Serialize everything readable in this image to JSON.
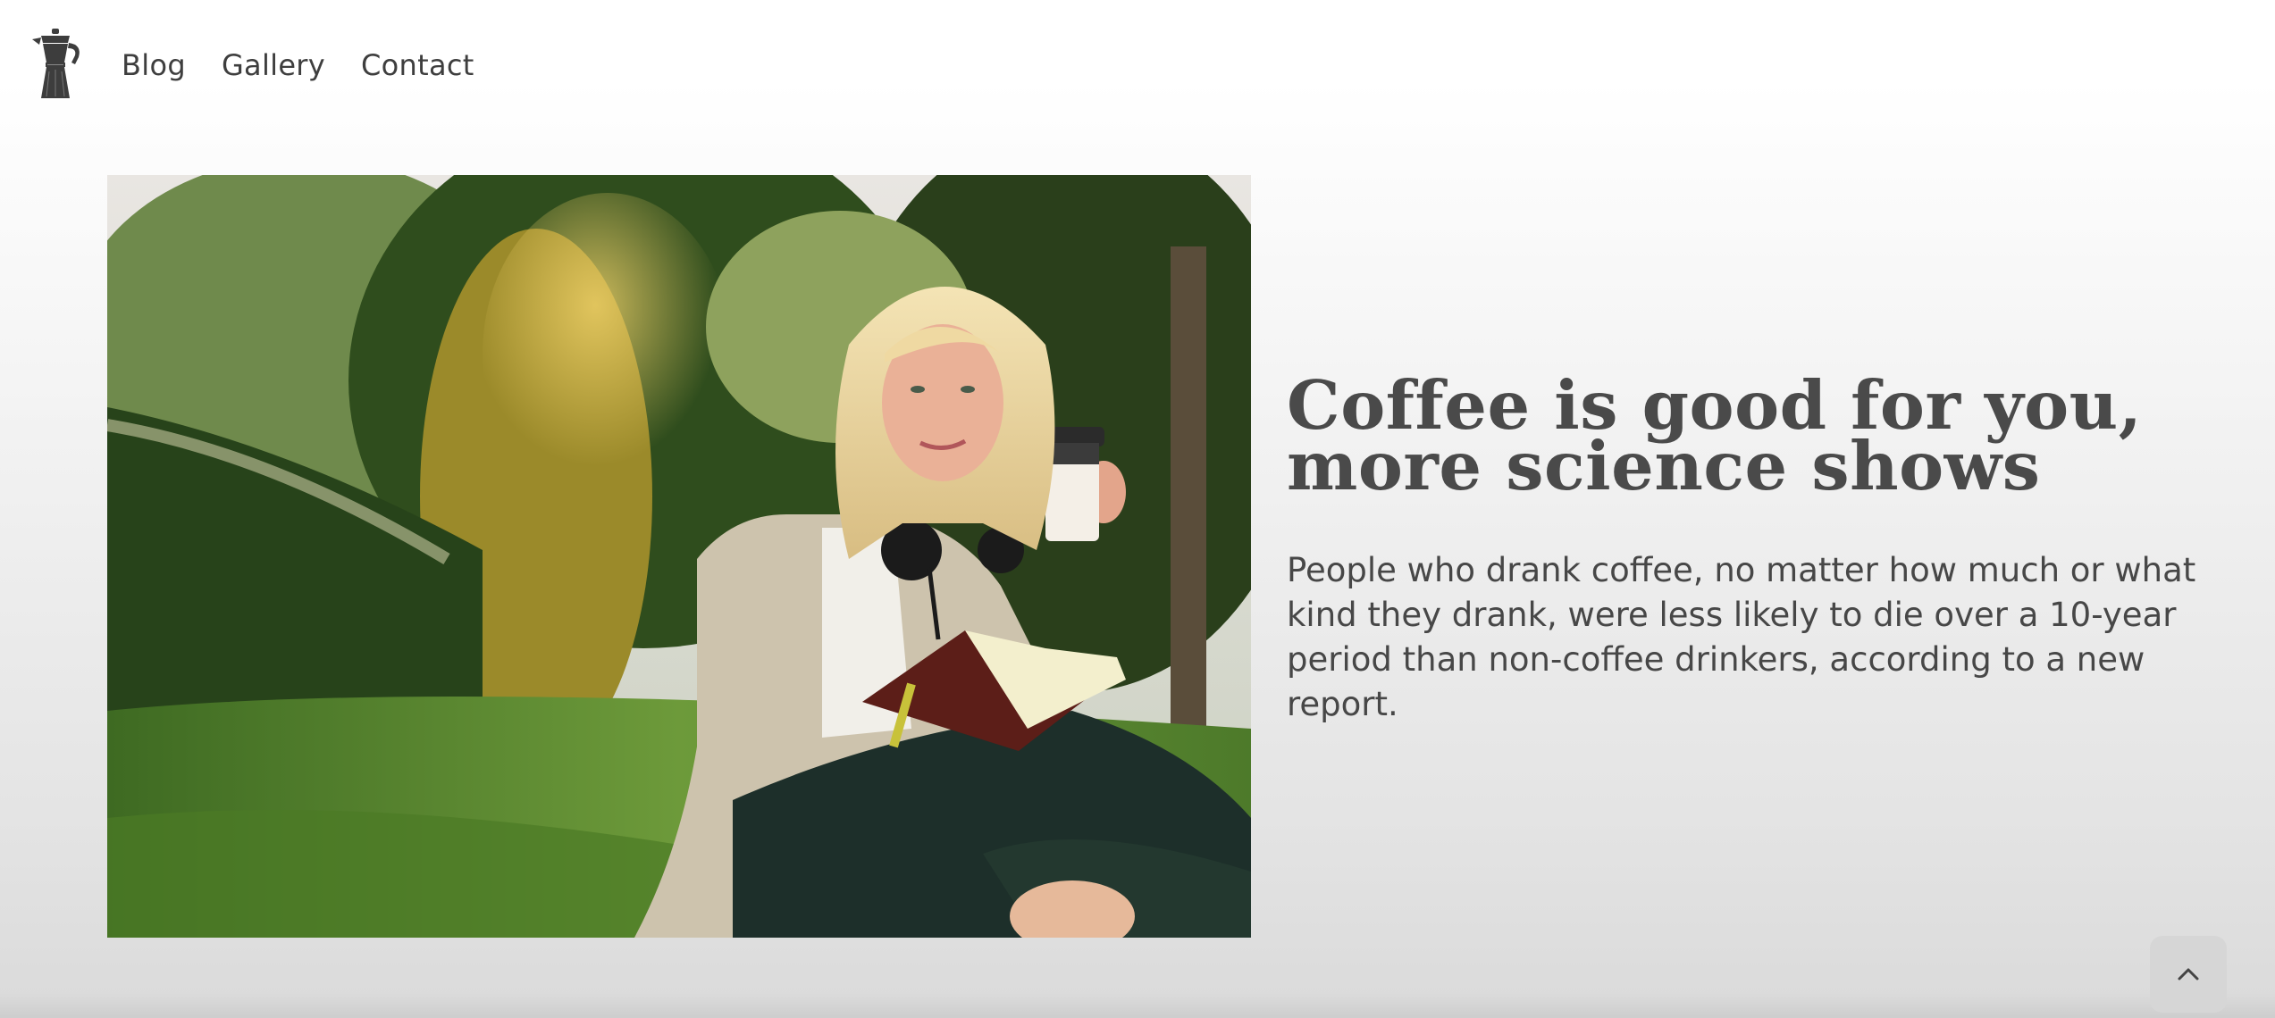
{
  "header": {
    "logo_icon": "moka-pot-icon",
    "nav": [
      {
        "label": "Blog"
      },
      {
        "label": "Gallery"
      },
      {
        "label": "Contact"
      }
    ]
  },
  "hero": {
    "headline": "Coffee is good for you, more science shows",
    "lede": "People who drank coffee, no matter how much or what kind they drank, were less likely to die over a 10-year period than non-coffee drinkers, according to a new report.",
    "image_subject": "woman-with-coffee-cup-and-book-photo"
  },
  "back_to_top": {
    "icon": "chevron-up-icon"
  },
  "colors": {
    "text": "#454545",
    "background_top": "#ffffff",
    "background_bottom": "#dadada",
    "button_bg": "#d6d6d6"
  }
}
